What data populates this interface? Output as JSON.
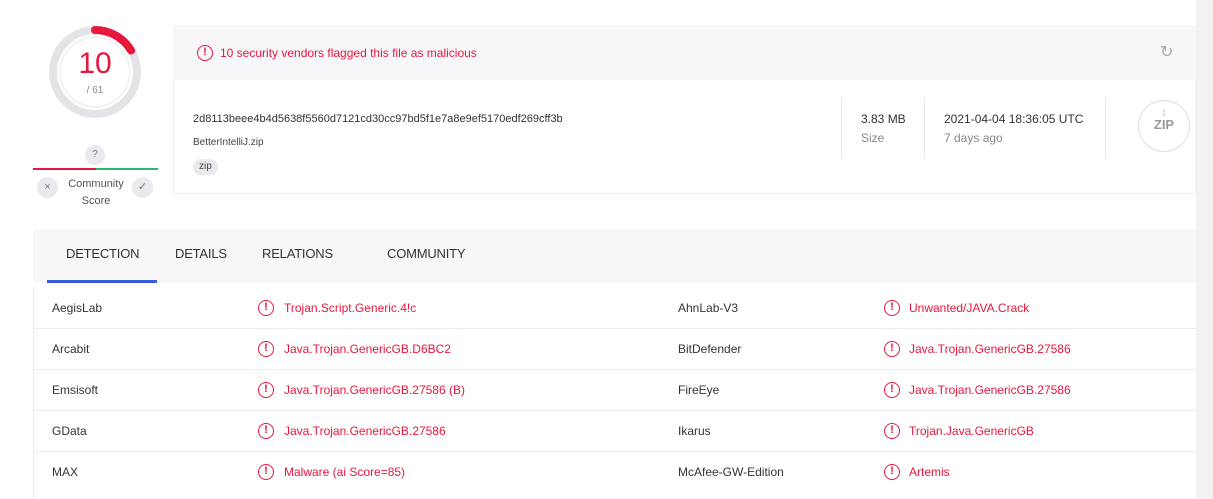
{
  "score": {
    "detections": "10",
    "total": "/ 61",
    "fraction_flagged": 0.164
  },
  "community": {
    "unknown_badge": "?",
    "down_glyph": "×",
    "up_glyph": "✓",
    "label_line1": "Community",
    "label_line2": "Score"
  },
  "banner": {
    "alert_icon": "!",
    "message": "10 security vendors flagged this file as malicious",
    "reload_icon": "↻"
  },
  "file": {
    "hash": "2d8113beee4b4d5638f5560d7121cd30cc97bd5f1e7a8e9ef5170edf269cff3b",
    "name": "BetterIntelliJ.zip",
    "tag": "zip",
    "size_value": "3.83 MB",
    "size_label": "Size",
    "date": "2021-04-04 18:36:05 UTC",
    "date_ago": "7 days ago",
    "type_icon_text": "ZIP",
    "type_icon_zipper": "⁞"
  },
  "tabs": [
    "DETECTION",
    "DETAILS",
    "RELATIONS",
    "COMMUNITY"
  ],
  "detections": [
    {
      "vendor_left": "AegisLab",
      "result_left": "Trojan.Script.Generic.4!c",
      "vendor_right": "AhnLab-V3",
      "result_right": "Unwanted/JAVA.Crack"
    },
    {
      "vendor_left": "Arcabit",
      "result_left": "Java.Trojan.GenericGB.D6BC2",
      "vendor_right": "BitDefender",
      "result_right": "Java.Trojan.GenericGB.27586"
    },
    {
      "vendor_left": "Emsisoft",
      "result_left": "Java.Trojan.GenericGB.27586 (B)",
      "vendor_right": "FireEye",
      "result_right": "Java.Trojan.GenericGB.27586"
    },
    {
      "vendor_left": "GData",
      "result_left": "Java.Trojan.GenericGB.27586",
      "vendor_right": "Ikarus",
      "result_right": "Trojan.Java.GenericGB"
    },
    {
      "vendor_left": "MAX",
      "result_left": "Malware (ai Score=85)",
      "vendor_right": "McAfee-GW-Edition",
      "result_right": "Artemis"
    }
  ],
  "result_icon": "!",
  "colors": {
    "malicious": "#e8173e",
    "accent": "#3a5bd9",
    "harmless": "#2bb673"
  }
}
